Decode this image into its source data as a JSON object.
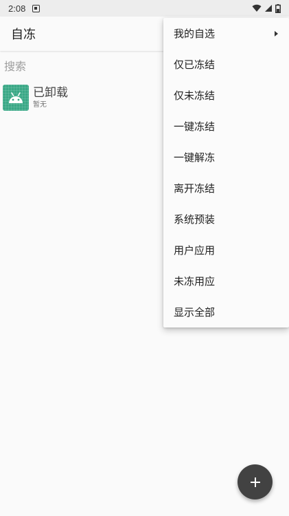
{
  "status_bar": {
    "time": "2:08",
    "icons": [
      "notification-a-icon",
      "wifi-icon",
      "signal-icon",
      "battery-icon"
    ]
  },
  "toolbar": {
    "title": "自冻"
  },
  "search": {
    "placeholder": "搜索",
    "value": ""
  },
  "app_list": [
    {
      "name": "已卸载",
      "subtitle": "暂无",
      "icon": "android-icon",
      "icon_color": "#3aa886"
    }
  ],
  "overflow_menu": {
    "items": [
      {
        "label": "我的自选",
        "has_submenu": true
      },
      {
        "label": "仅已冻结"
      },
      {
        "label": "仅未冻结"
      },
      {
        "label": "一键冻结"
      },
      {
        "label": "一键解冻"
      },
      {
        "label": "离开冻结"
      },
      {
        "label": "系统预装"
      },
      {
        "label": "用户应用"
      },
      {
        "label": "未冻用应"
      },
      {
        "label": "显示全部"
      }
    ]
  },
  "fab": {
    "icon": "plus-icon",
    "color": "#424242"
  }
}
